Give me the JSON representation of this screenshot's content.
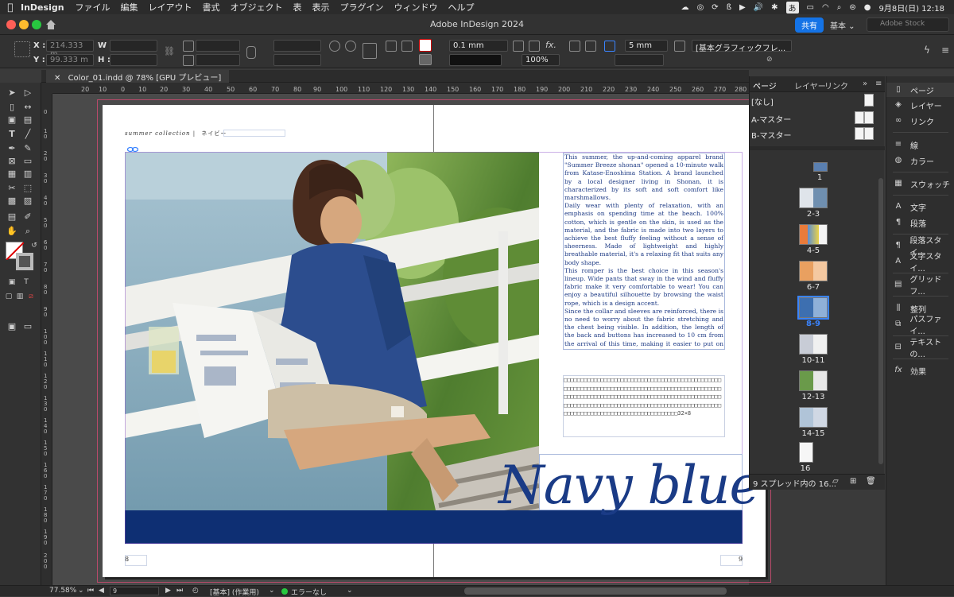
{
  "menubar": {
    "app_name": "InDesign",
    "items": [
      "ファイル",
      "編集",
      "レイアウト",
      "書式",
      "オブジェクト",
      "表",
      "表示",
      "プラグイン",
      "ウィンドウ",
      "ヘルプ"
    ],
    "input_method": "あ",
    "datetime": "9月8日(日) 12:18"
  },
  "titlebar": {
    "title": "Adobe InDesign 2024",
    "share_label": "共有",
    "workspace_label": "基本",
    "stock_placeholder": "Adobe Stock"
  },
  "control_panel": {
    "x_label": "X :",
    "y_label": "Y :",
    "w_label": "W :",
    "h_label": "H :",
    "x_value": "214.333 m",
    "y_value": "99.333 m",
    "stroke_weight": "0.1 mm",
    "opacity": "100%",
    "spacing": "5 mm",
    "object_style": "[基本グラフィックフレ...",
    "fx_label": "fx."
  },
  "document": {
    "tab_label": "Color_01.indd @ 78% [GPU プレビュー]",
    "ruler_h": [
      "20",
      "10",
      "0",
      "10",
      "20",
      "30",
      "40",
      "50",
      "60",
      "70",
      "80",
      "90",
      "100",
      "110",
      "120",
      "130",
      "140",
      "150",
      "160",
      "170",
      "180",
      "190",
      "200",
      "210",
      "220",
      "230",
      "240",
      "250",
      "260",
      "270",
      "280"
    ],
    "ruler_v": [
      "0",
      "10",
      "20",
      "30",
      "40",
      "50",
      "60",
      "70",
      "80",
      "90",
      "100",
      "110",
      "120",
      "130",
      "140",
      "150",
      "160",
      "170",
      "180",
      "190",
      "200"
    ]
  },
  "spread": {
    "running_head_en": "summer collection",
    "running_head_sep": "|",
    "running_head_jp": "ネイビー",
    "body_paragraphs": [
      "This summer, the up-and-coming apparel brand \"Summer Breeze shonan\" opened a 10-minute walk from Katase-Enoshima Station. A brand launched by a local designer living in Shonan, it is characterized by its soft and soft comfort like marshmallows.",
      "Daily wear with plenty of relaxation, with an emphasis on spending time at the beach. 100% cotton, which is gentle on the skin, is used as the material, and the fabric is made into two layers to achieve the best fluffy feeling without a sense of sheerness. Made of lightweight and highly breathable material, it's a relaxing fit that suits any body shape.",
      "This romper is the best choice in this season's lineup. Wide pants that sway in the wind and fluffy fabric make it very comfortable to wear! You can enjoy a beautiful silhouette by browsing the waist rope, which is a design accent.",
      "Since the collar and sleeves are reinforced, there is no need to worry about the fabric stretching and the chest being visible. In addition, the length of the back and buttons has increased to 10 cm from the arrival of this time, making it easier to put on and take off."
    ],
    "placeholder_text": "□□□□□□□□□□□□□□□□□□□□□□□□□□□□□□□□□□□□□□□□□□□□□□□□□□□□□□□□□□□□□□□□□□□□□□□□□□□□□□□□□□□□□□□□□□□□□□□□□□□□□□□□□□□□□□□□□□□□□□□□□□□□□□□□□□□□□□□□□□□□□□□□□□□□□□□□□□□□□□□□□□□□□□□□□□□□□□□□□□□□□□□□□□□□□□□□□□□□□□□□□□□□□□□□□□□□□□□□□□□□□□32×8",
    "title": "Navy blue",
    "folio_left": "8",
    "folio_right": "9"
  },
  "pages_panel": {
    "tabs": [
      "ページ",
      "レイヤー",
      "リンク"
    ],
    "masters": [
      "[なし]",
      "A-マスター",
      "B-マスター"
    ],
    "spreads": [
      "1",
      "2-3",
      "4-5",
      "6-7",
      "8-9",
      "10-11",
      "12-13",
      "14-15",
      "16"
    ],
    "selected_spread": "8-9",
    "footer": "9 スプレッド内の 16..."
  },
  "dock": {
    "items": [
      "ページ",
      "レイヤー",
      "リンク",
      "線",
      "カラー",
      "スウォッチ",
      "文字",
      "段落",
      "段落スタイ...",
      "文字スタイ...",
      "グリッドフ...",
      "整列",
      "パスファイ...",
      "テキストの...",
      "効果"
    ]
  },
  "statusbar": {
    "zoom": "77.58%",
    "page": "9",
    "profile": "[基本] (作業用)",
    "preflight": "エラーなし"
  },
  "colors": {
    "navy": "#0e2f73",
    "title_blue": "#1a3b86",
    "accent": "#1473e6"
  }
}
